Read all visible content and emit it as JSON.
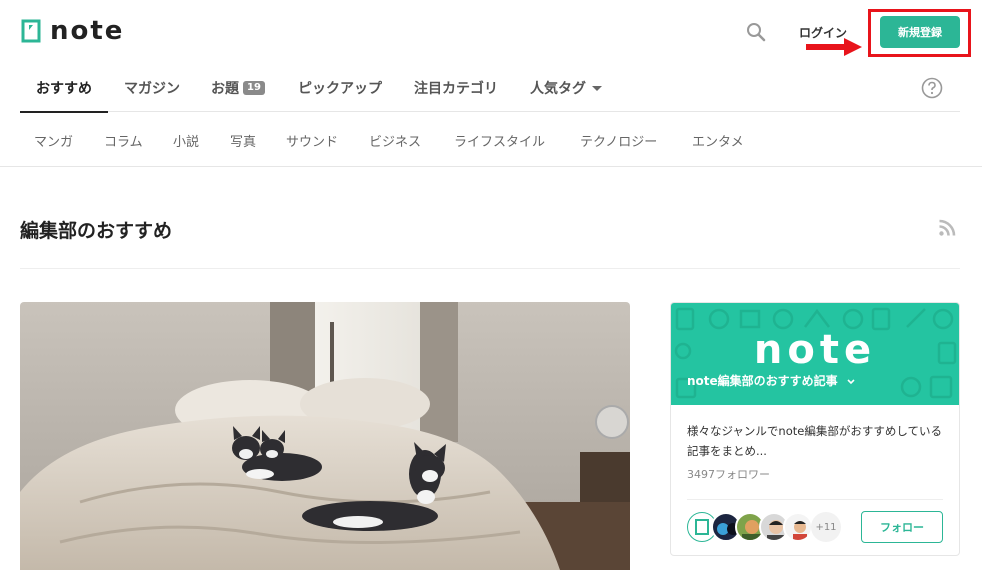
{
  "header": {
    "logo_text": "note",
    "search_icon": "search-icon",
    "login_label": "ログイン",
    "signup_label": "新規登録"
  },
  "tabs": [
    {
      "label": "おすすめ",
      "active": true
    },
    {
      "label": "マガジン"
    },
    {
      "label": "お題",
      "badge": "19"
    },
    {
      "label": "ピックアップ"
    },
    {
      "label": "注目カテゴリ"
    },
    {
      "label": "人気タグ",
      "dropdown": true
    }
  ],
  "help_icon": "question-circle-icon",
  "subcategories": [
    "マンガ",
    "コラム",
    "小説",
    "写真",
    "サウンド",
    "ビジネス",
    "ライフスタイル",
    "テクノロジー",
    "エンタメ"
  ],
  "section": {
    "title": "編集部のおすすめ",
    "rss_icon": "rss-icon"
  },
  "feature": {
    "image": "photo-of-cats-on-bed"
  },
  "magazine_card": {
    "banner_logo": "note",
    "banner_title": "note編集部のおすすめ記事",
    "description": "様々なジャンルでnote編集部がおすすめしている記事をまとめ...",
    "followers": "3497フォロワー",
    "more_count": "+11",
    "follow_label": "フォロー"
  },
  "colors": {
    "brand_green": "#2cb696",
    "highlight_red": "#e8141b"
  }
}
